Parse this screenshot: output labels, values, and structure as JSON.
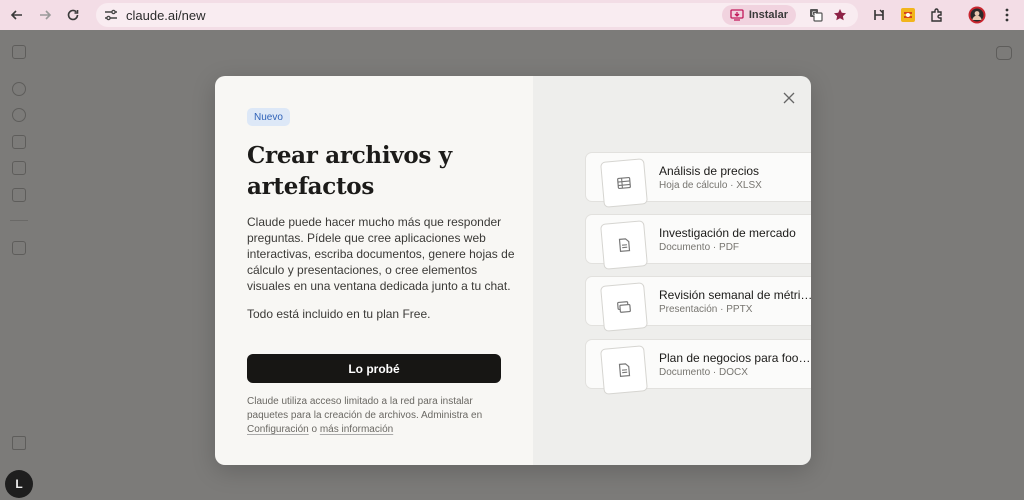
{
  "browser": {
    "url": "claude.ai/new",
    "install_label": "Instalar"
  },
  "app": {
    "avatar_initial": "L"
  },
  "modal": {
    "badge": "Nuevo",
    "title": "Crear archivos y artefactos",
    "description": "Claude puede hacer mucho más que responder preguntas. Pídele que cree aplicaciones web interactivas, escriba documentos, genere hojas de cálculo y presentaciones, o cree elementos visuales en una ventana dedicada junto a tu chat.",
    "included": "Todo está incluido en tu plan Free.",
    "cta_label": "Lo probé",
    "note_prefix": "Claude utiliza acceso limitado a la red para instalar paquetes para la creación de archivos. Administra en ",
    "note_link_settings": "Configuración",
    "note_middle": " o ",
    "note_link_more": "más información",
    "files": [
      {
        "name": "Análisis de precios",
        "type": "Hoja de cálculo · XLSX",
        "icon": "spreadsheet-icon"
      },
      {
        "name": "Investigación de mercado",
        "type": "Documento · PDF",
        "icon": "document-icon"
      },
      {
        "name": "Revisión semanal de métricas",
        "type": "Presentación · PPTX",
        "icon": "presentation-icon"
      },
      {
        "name": "Plan de negocios para food…",
        "type": "Documento · DOCX",
        "icon": "document-icon"
      }
    ]
  }
}
